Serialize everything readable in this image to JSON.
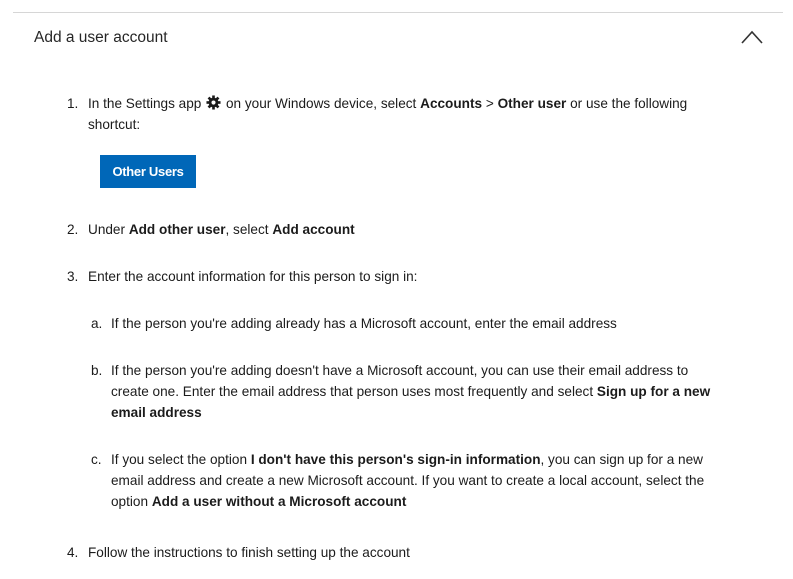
{
  "accordion": {
    "title": "Add a user account",
    "chevron_icon": "chevron-up-icon"
  },
  "steps": {
    "s1": {
      "num": "1.",
      "text_a": "In the Settings app",
      "settings_icon": "settings-gear-icon",
      "text_b": "on your Windows device, select",
      "bold_a": "Accounts",
      "sep": ">",
      "bold_b": "Other user",
      "text_c": "or use the following shortcut:",
      "button": "Other Users"
    },
    "s2": {
      "num": "2.",
      "text_a": "Under",
      "bold_a": "Add other user",
      "text_b": ", select",
      "bold_b": "Add account"
    },
    "s3": {
      "num": "3.",
      "text": "Enter the account information for this person to sign in:",
      "a": {
        "num": "a.",
        "text": "If the person you're adding already has a Microsoft account, enter the email address"
      },
      "b": {
        "num": "b.",
        "text_a": "If the person you're adding doesn't have a Microsoft account, you can use their email address to create one. Enter the email address that person uses most frequently and select",
        "bold_a": "Sign up for a new email address"
      },
      "c": {
        "num": "c.",
        "text_a": "If you select the option",
        "bold_a": "I don't have this person's sign-in information",
        "text_b": ", you can sign up for a new email address and create a new Microsoft account. If you want to create a local account, select the option",
        "bold_b": "Add a user without a Microsoft account"
      }
    },
    "s4": {
      "num": "4.",
      "text": "Follow the instructions to finish setting up the account"
    }
  }
}
